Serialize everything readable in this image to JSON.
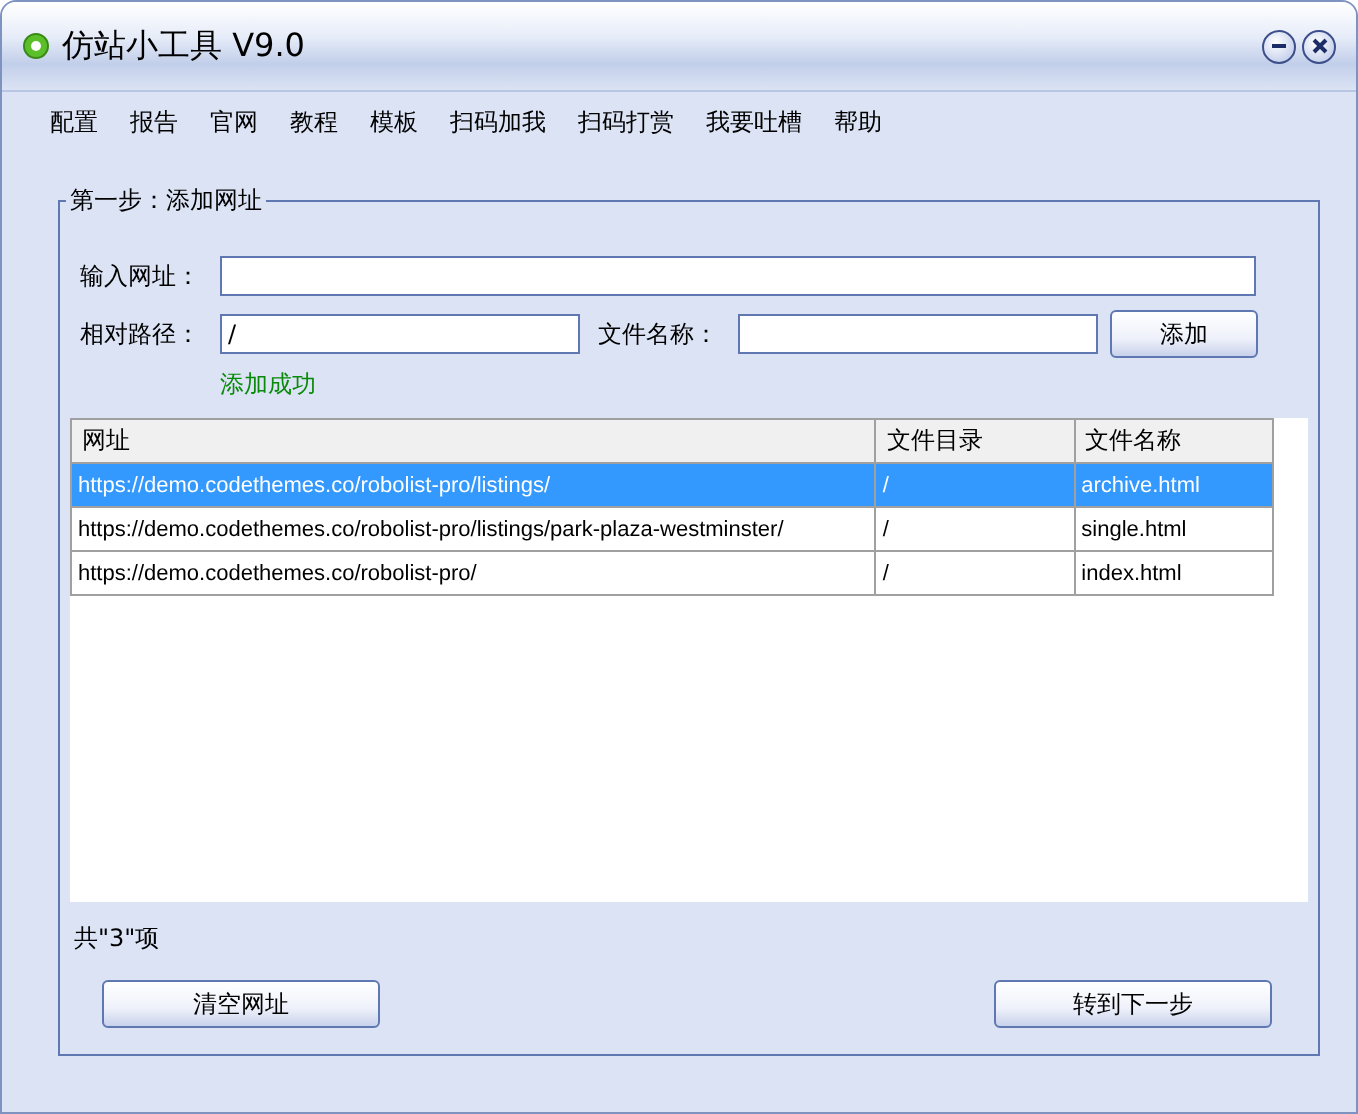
{
  "window": {
    "title": "仿站小工具 V9.0"
  },
  "menu": [
    "配置",
    "报告",
    "官网",
    "教程",
    "模板",
    "扫码加我",
    "扫码打赏",
    "我要吐槽",
    "帮助"
  ],
  "group": {
    "title": "第一步：添加网址"
  },
  "url_field": {
    "label": "输入网址："
  },
  "path_field": {
    "label": "相对路径：",
    "value": "/"
  },
  "name_field": {
    "label": "文件名称："
  },
  "add_button": "添加",
  "status_message": "添加成功",
  "table": {
    "columns": [
      "网址",
      "文件目录",
      "文件名称"
    ],
    "rows": [
      {
        "cells": [
          "https://demo.codethemes.co/robolist-pro/listings/",
          "/",
          "archive.html"
        ],
        "selected": true
      },
      {
        "cells": [
          "https://demo.codethemes.co/robolist-pro/listings/park-plaza-westminster/",
          "/",
          "single.html"
        ],
        "selected": false
      },
      {
        "cells": [
          "https://demo.codethemes.co/robolist-pro/",
          "/",
          "index.html"
        ],
        "selected": false
      }
    ]
  },
  "count": "共\"3\"项",
  "buttons": [
    "清空网址",
    "转到下一步"
  ]
}
